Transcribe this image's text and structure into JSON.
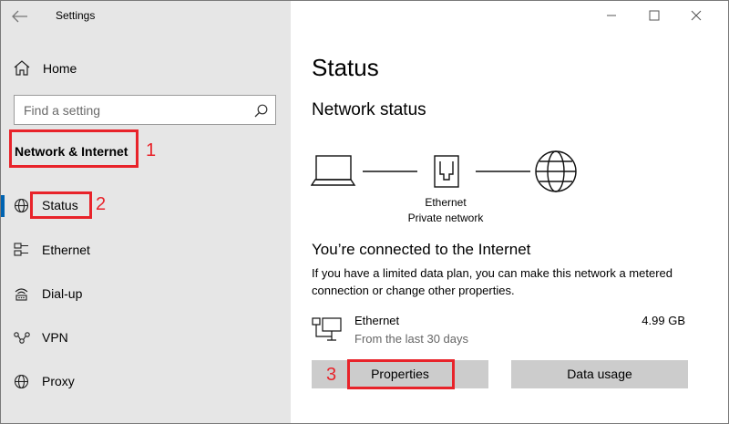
{
  "window": {
    "title": "Settings"
  },
  "sidebar": {
    "home_label": "Home",
    "search_placeholder": "Find a setting",
    "section_heading": "Network & Internet",
    "items": [
      {
        "label": "Status",
        "icon": "globe-icon",
        "active": true
      },
      {
        "label": "Ethernet",
        "icon": "ethernet-icon"
      },
      {
        "label": "Dial-up",
        "icon": "dialup-icon"
      },
      {
        "label": "VPN",
        "icon": "vpn-icon"
      },
      {
        "label": "Proxy",
        "icon": "proxy-globe-icon"
      }
    ]
  },
  "annotations": {
    "n1": "1",
    "n2": "2",
    "n3": "3",
    "color": "#e8232a"
  },
  "main": {
    "title": "Status",
    "subtitle": "Network status",
    "diagram": {
      "line1": "Ethernet",
      "line2": "Private network"
    },
    "connected_title": "You’re connected to the Internet",
    "connected_desc": "If you have a limited data plan, you can make this network a metered connection or change other properties.",
    "ethernet": {
      "name": "Ethernet",
      "period": "From the last 30 days",
      "usage": "4.99 GB"
    },
    "buttons": {
      "properties": "Properties",
      "data_usage": "Data usage"
    }
  },
  "colors": {
    "sidebar_bg": "#e6e6e6",
    "accent": "#0063b1",
    "button_bg": "#cccccc"
  }
}
